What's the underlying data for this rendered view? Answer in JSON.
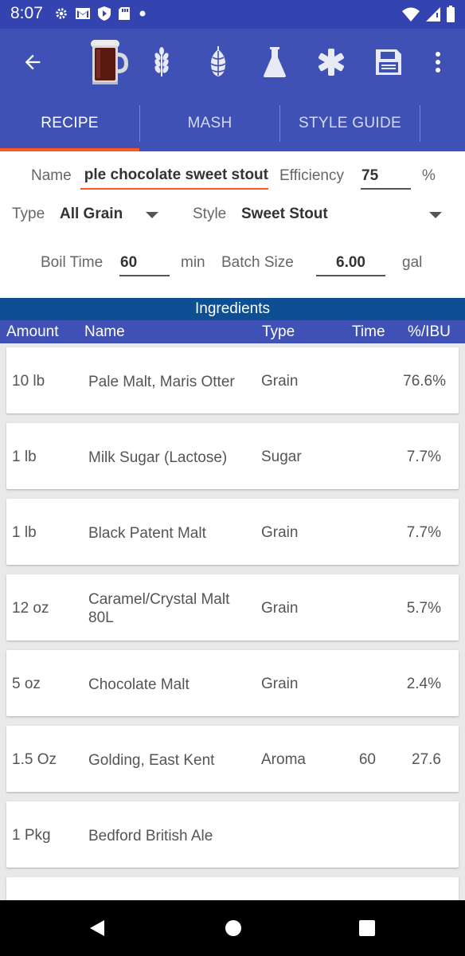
{
  "status": {
    "time": "8:07"
  },
  "tabs": [
    {
      "label": "RECIPE"
    },
    {
      "label": "MASH"
    },
    {
      "label": "STYLE GUIDE"
    }
  ],
  "form": {
    "name_label": "Name",
    "name_value": "ple chocolate sweet stout",
    "efficiency_label": "Efficiency",
    "efficiency_value": "75",
    "efficiency_unit": "%",
    "type_label": "Type",
    "type_value": "All Grain",
    "style_label": "Style",
    "style_value": "Sweet Stout",
    "boil_label": "Boil Time",
    "boil_value": "60",
    "boil_unit": "min",
    "batch_label": "Batch Size",
    "batch_value": "6.00",
    "batch_unit": "gal"
  },
  "ingredients": {
    "title": "Ingredients",
    "columns": {
      "amount": "Amount",
      "name": "Name",
      "type": "Type",
      "time": "Time",
      "ibu": "%/IBU"
    },
    "rows": [
      {
        "amount": "10 lb",
        "name": "Pale Malt, Maris Otter",
        "type": "Grain",
        "time": "",
        "ibu": "76.6%"
      },
      {
        "amount": "1 lb",
        "name": "Milk Sugar (Lactose)",
        "type": "Sugar",
        "time": "",
        "ibu": "7.7%"
      },
      {
        "amount": "1 lb",
        "name": "Black Patent Malt",
        "type": "Grain",
        "time": "",
        "ibu": "7.7%"
      },
      {
        "amount": "12 oz",
        "name": "Caramel/Crystal Malt 80L",
        "type": "Grain",
        "time": "",
        "ibu": "5.7%"
      },
      {
        "amount": "5 oz",
        "name": "Chocolate Malt",
        "type": "Grain",
        "time": "",
        "ibu": "2.4%"
      },
      {
        "amount": "1.5 Oz",
        "name": "Golding, East Kent",
        "type": "Aroma",
        "time": "60",
        "ibu": "27.6"
      },
      {
        "amount": "1 Pkg",
        "name": "Bedford British Ale",
        "type": "",
        "time": "",
        "ibu": ""
      },
      {
        "amount": "",
        "name": "",
        "type": "",
        "time": "",
        "ibu": ""
      }
    ]
  },
  "icons": {
    "toolbar": [
      "back-arrow-icon",
      "beer-mug-icon",
      "grain-icon",
      "hop-icon",
      "flask-icon",
      "asterisk-icon",
      "save-icon",
      "more-vert-icon"
    ]
  },
  "colors": {
    "primary": "#3f51b5",
    "status_bar": "#3343b0",
    "accent": "#ff5722",
    "ingredients_header": "#0d4f92"
  }
}
